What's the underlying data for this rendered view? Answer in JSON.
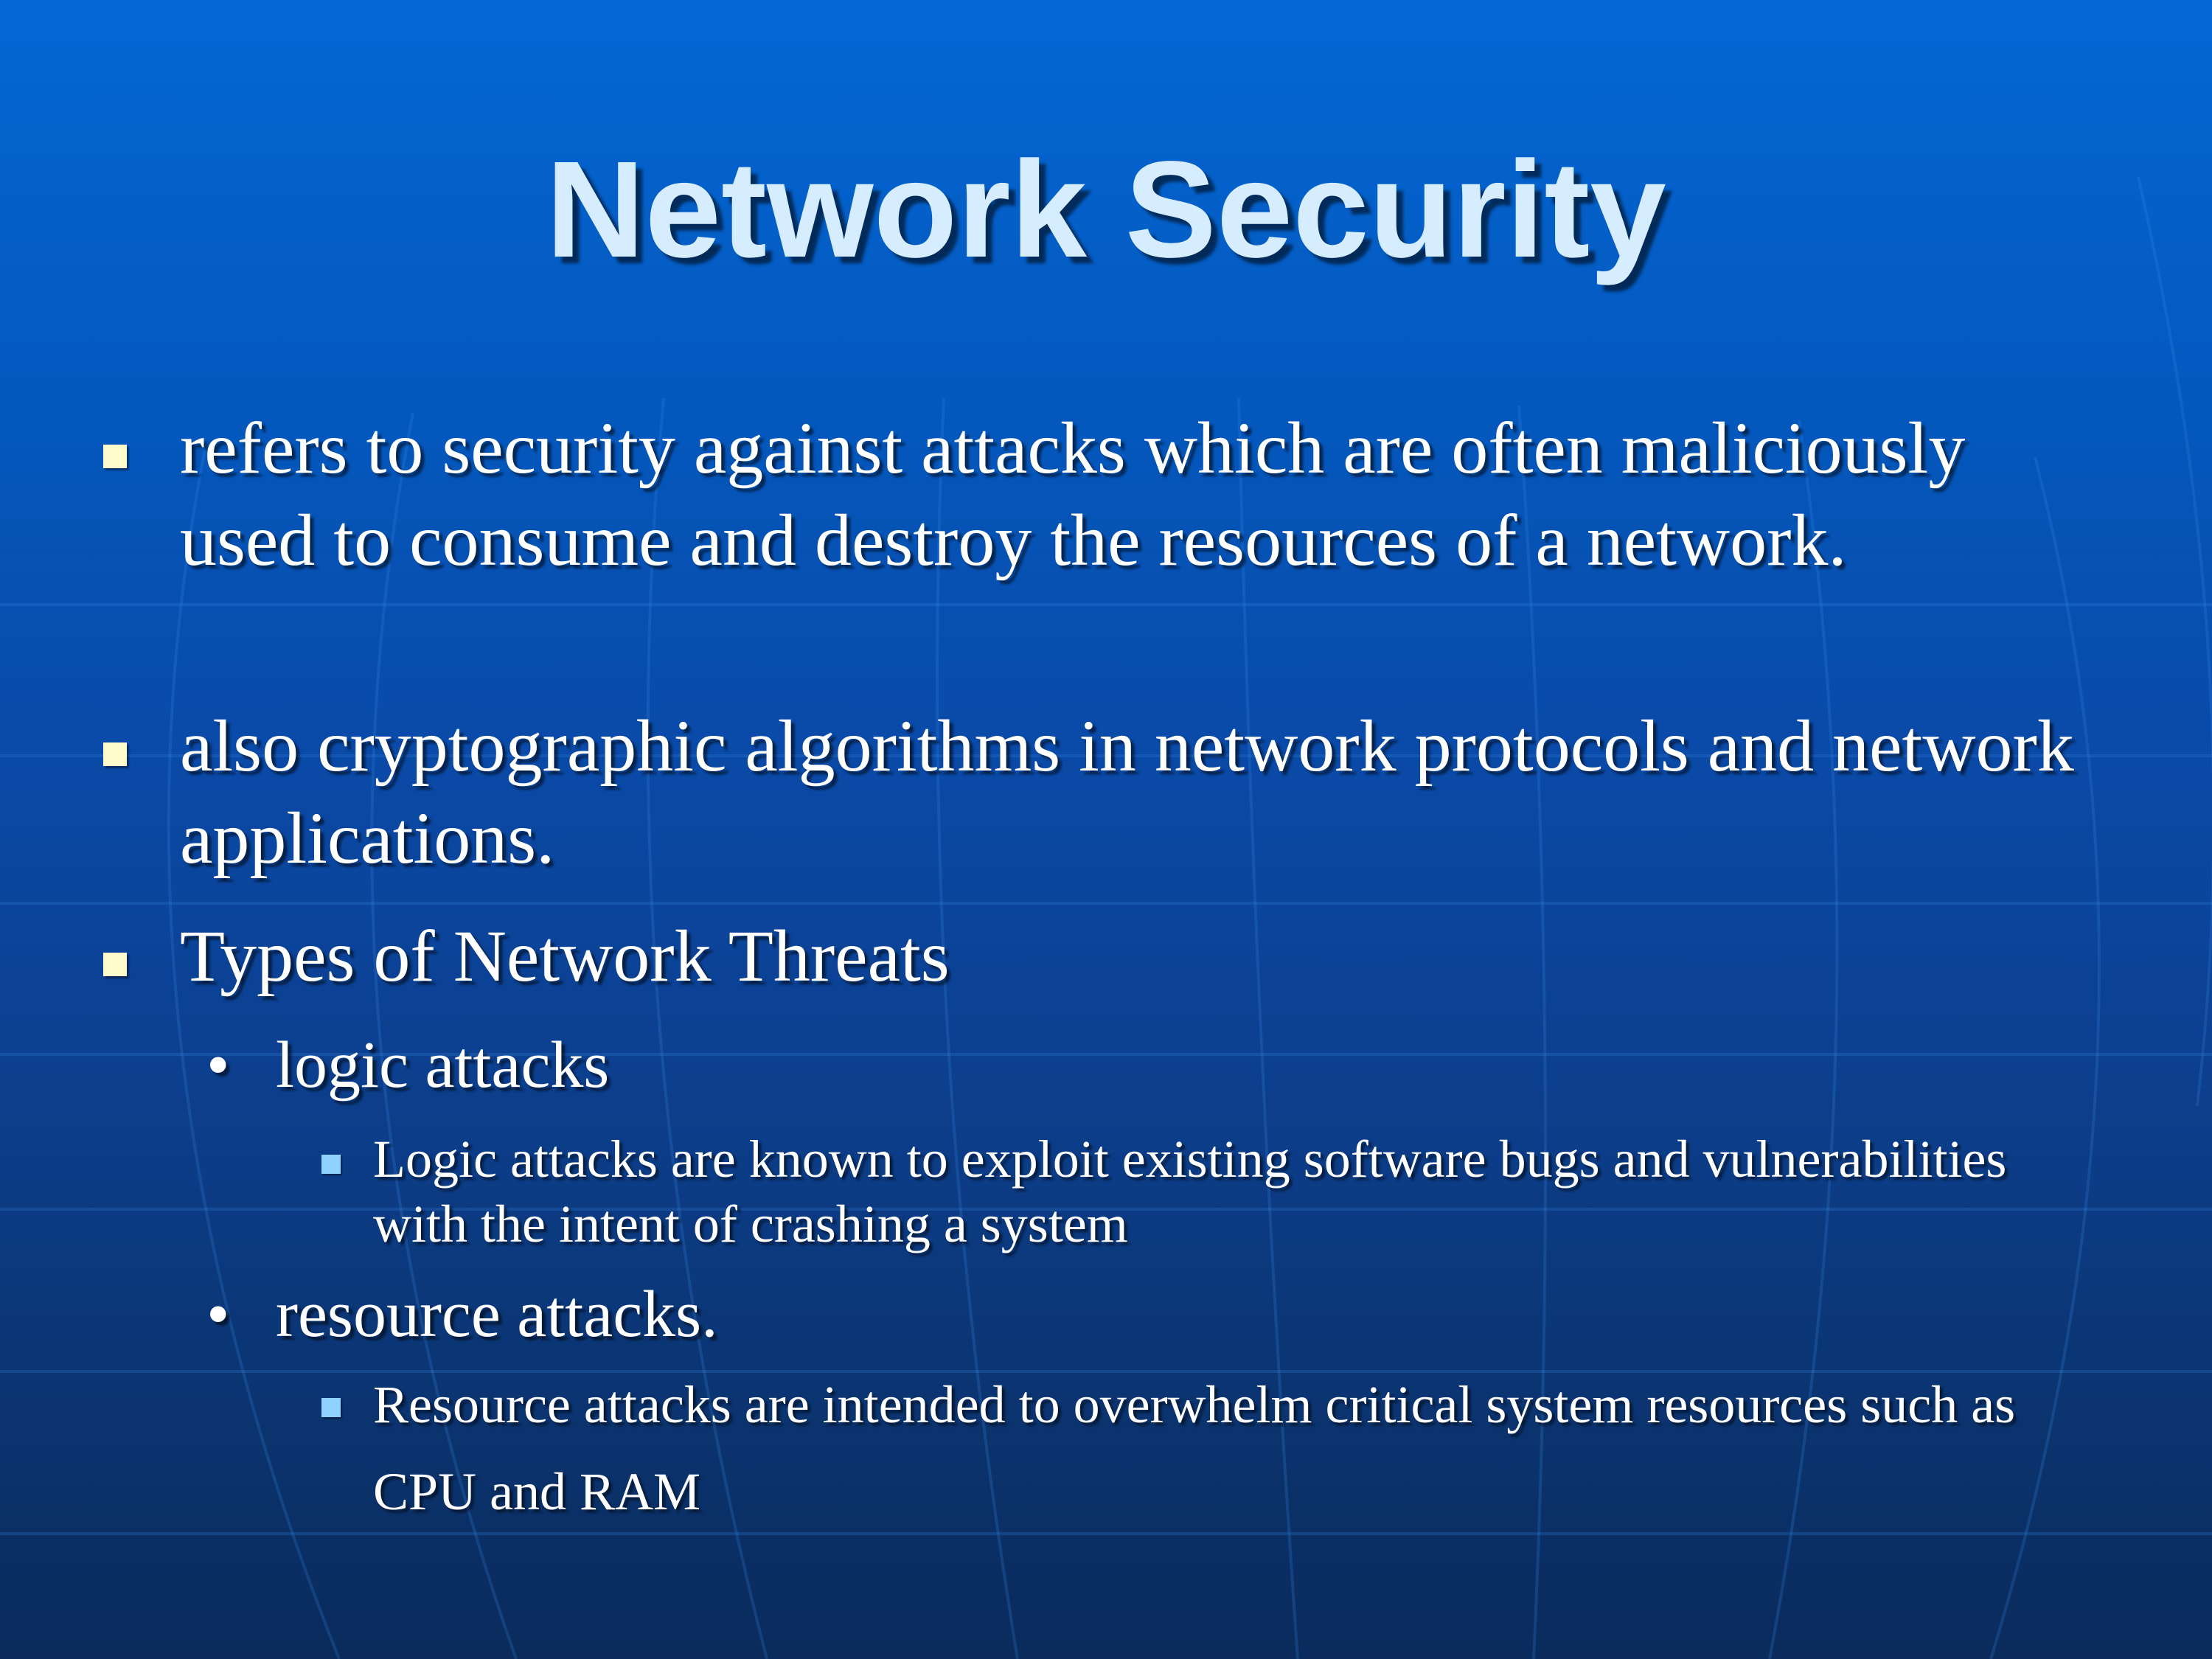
{
  "slide": {
    "title": "Network Security",
    "bullets": [
      "refers to security against attacks which are often maliciously used to consume and destroy the resources of a network.",
      "also cryptographic algorithms in network protocols and network applications.",
      "Types of Network Threats"
    ],
    "threat_types": [
      {
        "label": "logic attacks",
        "detail": "Logic attacks are known to exploit existing software bugs and vulnerabilities with the intent of crashing a system"
      },
      {
        "label": "resource attacks.",
        "detail": "Resource attacks are intended to overwhelm critical system resources such as CPU and RAM"
      }
    ],
    "bullet_glyph": "•"
  },
  "colors": {
    "background_top": "#0467d4",
    "background_bottom": "#0a2b5c",
    "title": "#d6ecff",
    "text": "#ffffff",
    "level1_marker": "#fffccb",
    "level3_marker": "#8fd2ff"
  }
}
